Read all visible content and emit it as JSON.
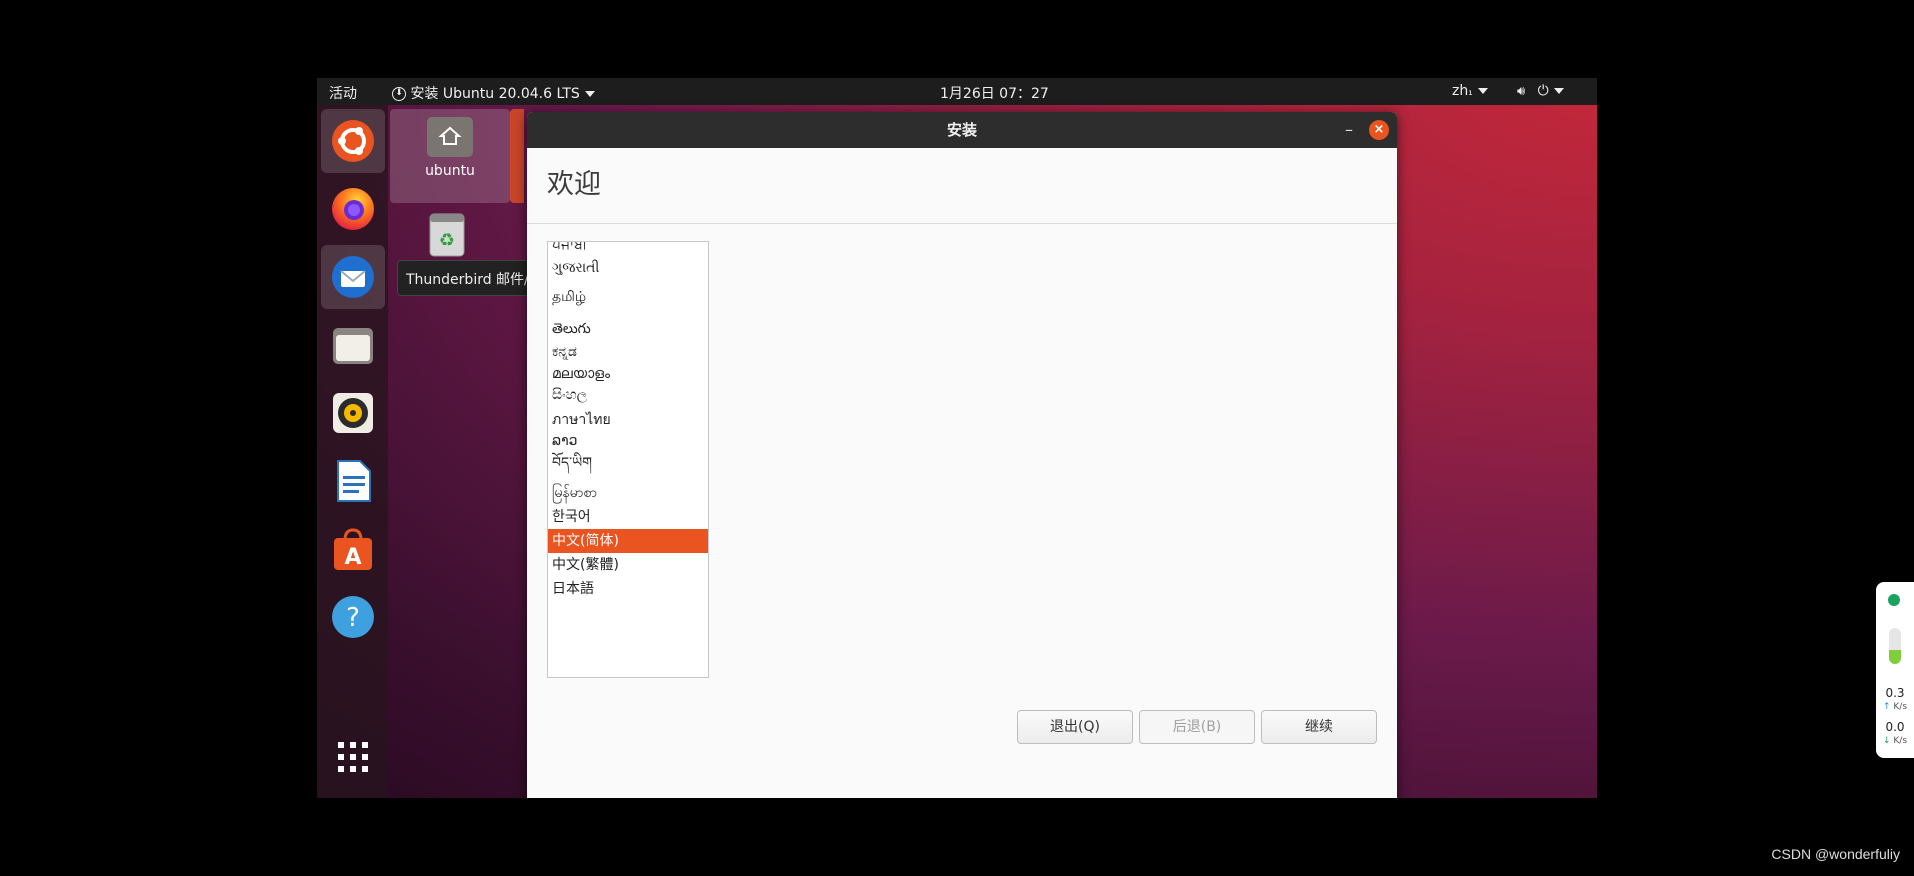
{
  "topbar": {
    "activities": "活动",
    "app_menu": "安装 Ubuntu 20.04.6 LTS",
    "clock": "1月26日  07：27",
    "input_method": "zh",
    "input_method_sub": "₁"
  },
  "dock": {
    "items": [
      {
        "name": "ubuntu-installer",
        "icon": "ubuntu-logo-icon",
        "active": true
      },
      {
        "name": "firefox",
        "icon": "firefox-icon"
      },
      {
        "name": "thunderbird",
        "icon": "thunderbird-icon",
        "hovered": true
      },
      {
        "name": "files",
        "icon": "files-icon"
      },
      {
        "name": "rhythmbox",
        "icon": "rhythmbox-icon"
      },
      {
        "name": "libreoffice-writer",
        "icon": "writer-icon"
      },
      {
        "name": "ubuntu-software",
        "icon": "software-icon"
      },
      {
        "name": "help",
        "icon": "help-icon"
      },
      {
        "name": "show-applications",
        "icon": "app-grid-icon"
      }
    ],
    "tooltip": "Thunderbird 邮件/新闻"
  },
  "desktop": {
    "home_label": "ubuntu"
  },
  "window": {
    "title": "安装",
    "minimize": "–",
    "close": "×",
    "heading": "欢迎",
    "languages": [
      "ਪੰਜਾਬੀ",
      "ગુજરાતી",
      "தமிழ்",
      "తెలుగు",
      "ಕನ್ನಡ",
      "മലയാളം",
      "සිංහල",
      "ภาษาไทย",
      "ລາວ",
      "བོད་ཡིག",
      "မြန်မာစာ",
      "한국어",
      "中文(简体)",
      "中文(繁體)",
      "日本語"
    ],
    "selected_language": "中文(简体)",
    "buttons": {
      "quit": "退出(Q)",
      "back": "后退(B)",
      "continue": "继续"
    }
  },
  "net_widget": {
    "upload_value": "0.3",
    "upload_unit": "K/s",
    "download_value": "0.0",
    "download_unit": "K/s"
  },
  "watermark": "CSDN @wonderfuliy",
  "colors": {
    "accent": "#e95420",
    "topbar": "#1d1d1d",
    "titlebar": "#2d2d2d"
  }
}
